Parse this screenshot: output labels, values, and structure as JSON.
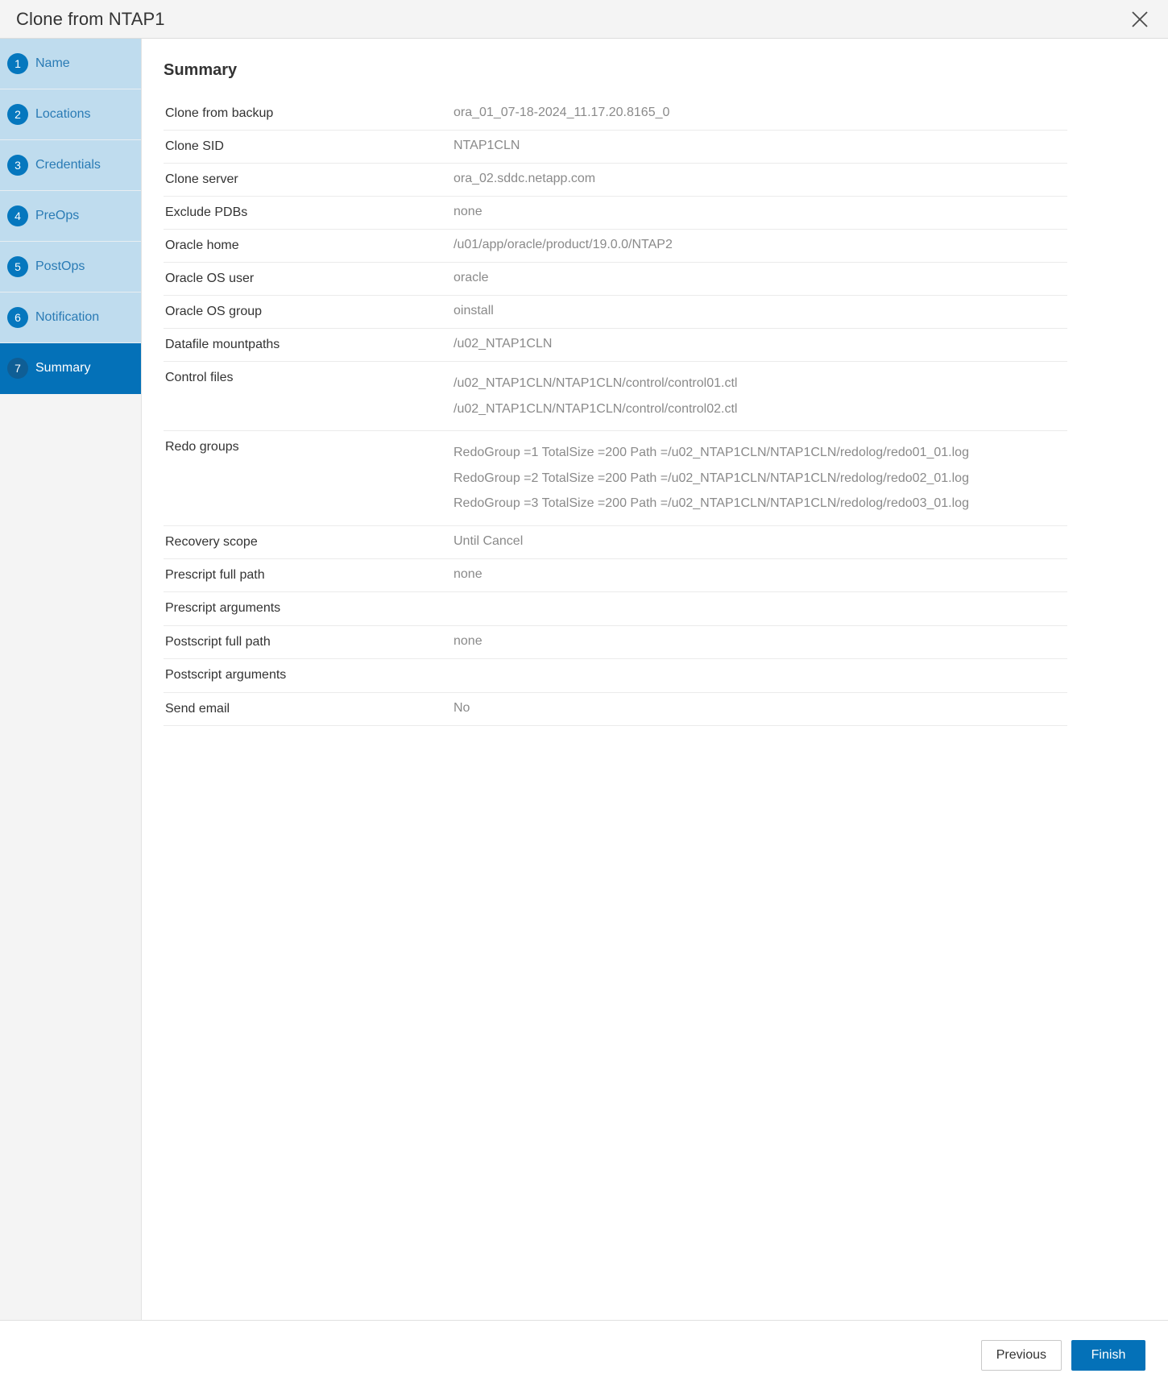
{
  "dialog": {
    "title": "Clone from NTAP1",
    "close_icon": "close-icon"
  },
  "sidebar": {
    "steps": [
      {
        "num": "1",
        "label": "Name",
        "active": false
      },
      {
        "num": "2",
        "label": "Locations",
        "active": false
      },
      {
        "num": "3",
        "label": "Credentials",
        "active": false
      },
      {
        "num": "4",
        "label": "PreOps",
        "active": false
      },
      {
        "num": "5",
        "label": "PostOps",
        "active": false
      },
      {
        "num": "6",
        "label": "Notification",
        "active": false
      },
      {
        "num": "7",
        "label": "Summary",
        "active": true
      }
    ]
  },
  "main": {
    "heading": "Summary",
    "rows": [
      {
        "key": "Clone from backup",
        "values": [
          "ora_01_07-18-2024_11.17.20.8165_0"
        ]
      },
      {
        "key": "Clone SID",
        "values": [
          "NTAP1CLN"
        ]
      },
      {
        "key": "Clone server",
        "values": [
          "ora_02.sddc.netapp.com"
        ]
      },
      {
        "key": "Exclude PDBs",
        "values": [
          "none"
        ]
      },
      {
        "key": "Oracle home",
        "values": [
          "/u01/app/oracle/product/19.0.0/NTAP2"
        ]
      },
      {
        "key": "Oracle OS user",
        "values": [
          "oracle"
        ]
      },
      {
        "key": "Oracle OS group",
        "values": [
          "oinstall"
        ]
      },
      {
        "key": "Datafile mountpaths",
        "values": [
          "/u02_NTAP1CLN"
        ]
      },
      {
        "key": "Control files",
        "values": [
          "/u02_NTAP1CLN/NTAP1CLN/control/control01.ctl",
          "/u02_NTAP1CLN/NTAP1CLN/control/control02.ctl"
        ]
      },
      {
        "key": "Redo groups",
        "values": [
          "RedoGroup =1 TotalSize =200 Path =/u02_NTAP1CLN/NTAP1CLN/redolog/redo01_01.log",
          "RedoGroup =2 TotalSize =200 Path =/u02_NTAP1CLN/NTAP1CLN/redolog/redo02_01.log",
          "RedoGroup =3 TotalSize =200 Path =/u02_NTAP1CLN/NTAP1CLN/redolog/redo03_01.log"
        ]
      },
      {
        "key": "Recovery scope",
        "values": [
          "Until Cancel"
        ]
      },
      {
        "key": "Prescript full path",
        "values": [
          "none"
        ]
      },
      {
        "key": "Prescript arguments",
        "values": [
          ""
        ]
      },
      {
        "key": "Postscript full path",
        "values": [
          "none"
        ]
      },
      {
        "key": "Postscript arguments",
        "values": [
          ""
        ]
      },
      {
        "key": "Send email",
        "values": [
          "No"
        ]
      }
    ]
  },
  "footer": {
    "previous_label": "Previous",
    "finish_label": "Finish"
  },
  "colors": {
    "accent": "#0471b8",
    "step_bg": "#bfdcee",
    "titlebar_bg": "#f4f4f4",
    "value_text": "#8a8a8a",
    "key_text": "#333333"
  }
}
